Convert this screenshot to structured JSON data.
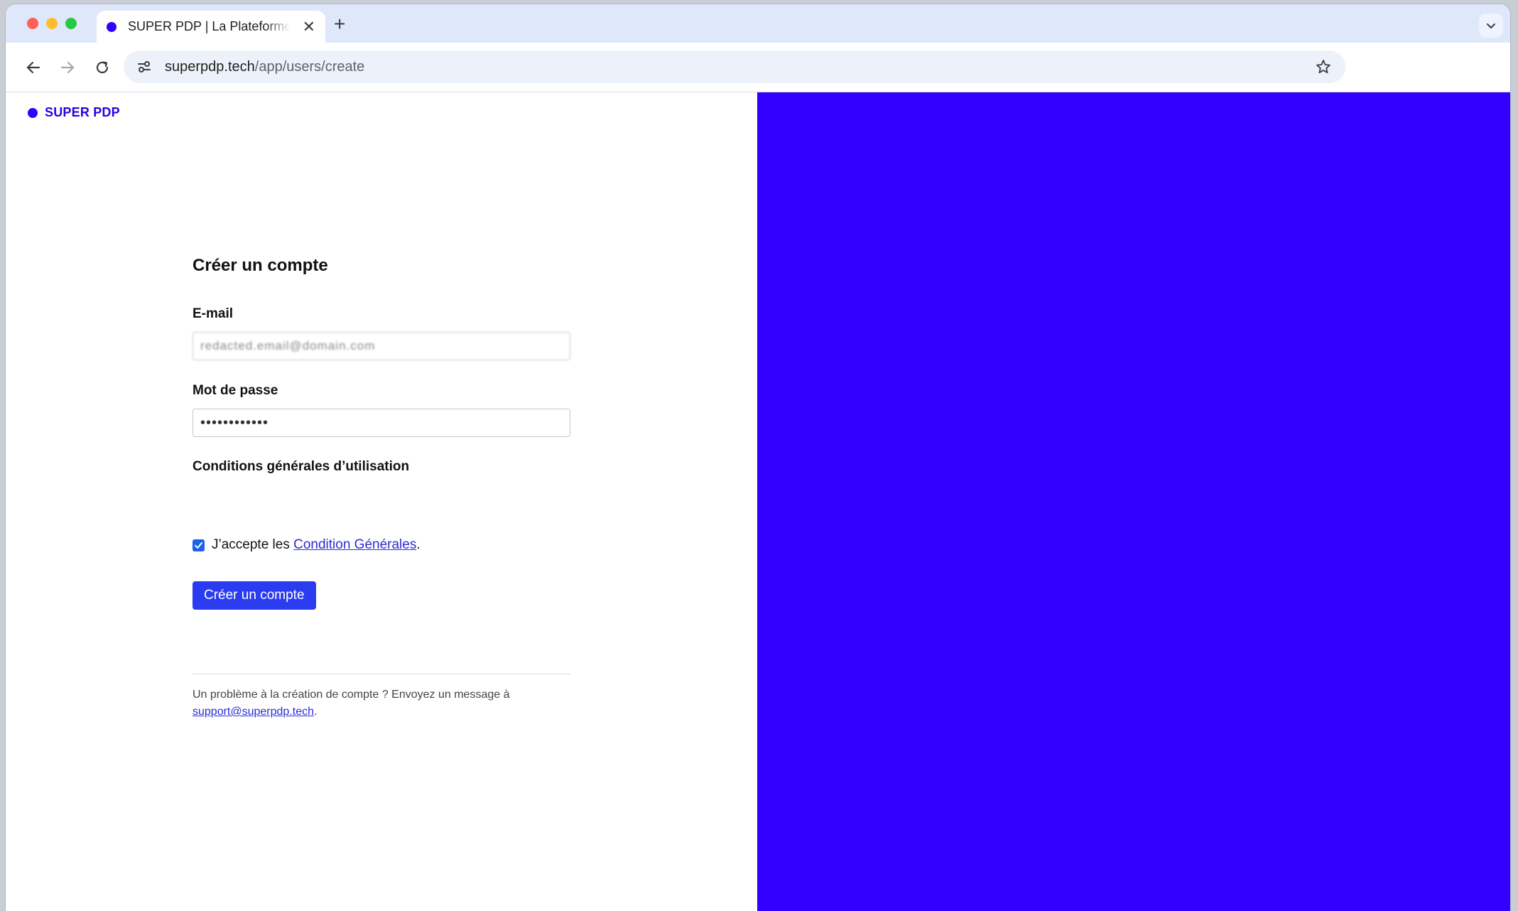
{
  "browser": {
    "tab": {
      "title": "SUPER PDP | La Plateforme Agréée",
      "favicon_color": "#3300ff"
    },
    "url": {
      "host": "superpdp.tech",
      "path": "/app/users/create"
    }
  },
  "brand": {
    "name": "SUPER PDP",
    "color": "#3300ff"
  },
  "form": {
    "title": "Créer un compte",
    "email": {
      "label": "E-mail",
      "value": "redacted.email@domain.com"
    },
    "password": {
      "label": "Mot de passe",
      "value": "••••••••••••"
    },
    "terms": {
      "heading": "Conditions générales d’utilisation",
      "checked": true,
      "prefix": "J’accepte les ",
      "link_label": "Condition Générales",
      "suffix": "."
    },
    "submit_label": "Créer un compte"
  },
  "help": {
    "text": "Un problème à la création de compte ? Envoyez un message à ",
    "email": "support@superpdp.tech",
    "suffix": "."
  },
  "colors": {
    "accent": "#3300ff",
    "button": "#2b3cf0"
  }
}
